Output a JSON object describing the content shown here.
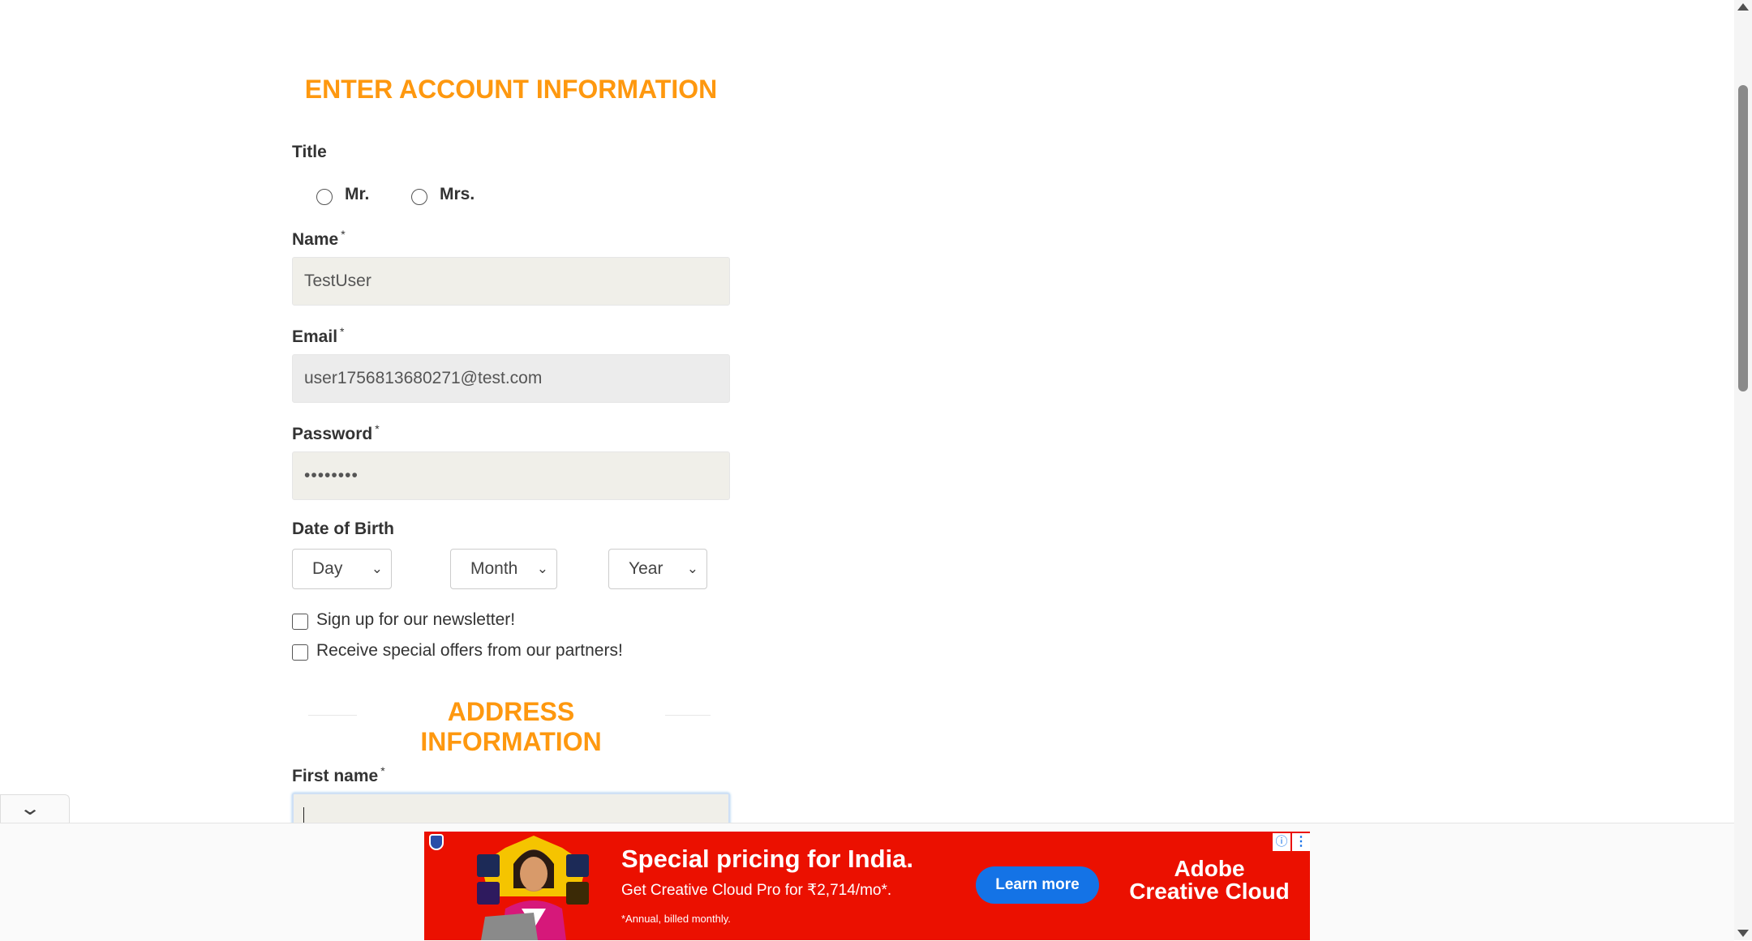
{
  "form": {
    "account_heading": "ENTER ACCOUNT INFORMATION",
    "title_label": "Title",
    "title_options": [
      "Mr.",
      "Mrs."
    ],
    "name_label": "Name",
    "name_value": "TestUser",
    "email_label": "Email",
    "email_value": "user1756813680271@test.com",
    "password_label": "Password",
    "password_value": "••••••••",
    "required_mark": "*",
    "dob_label": "Date of Birth",
    "dob_day": "Day",
    "dob_month": "Month",
    "dob_year": "Year",
    "newsletter_label": "Sign up for our newsletter!",
    "offers_label": "Receive special offers from our partners!",
    "address_heading": "ADDRESS INFORMATION",
    "firstname_label": "First name",
    "firstname_value": ""
  },
  "ad": {
    "headline": "Special pricing for India.",
    "subline": "Get Creative Cloud Pro for ₹2,714/mo*.",
    "note": "*Annual, billed monthly.",
    "button": "Learn more",
    "brand_line1": "Adobe",
    "brand_line2": "Creative Cloud",
    "background_color": "#eb1000",
    "button_color": "#1473e6"
  },
  "colors": {
    "heading": "#fe980f",
    "field_bg": "#f0efe9"
  }
}
